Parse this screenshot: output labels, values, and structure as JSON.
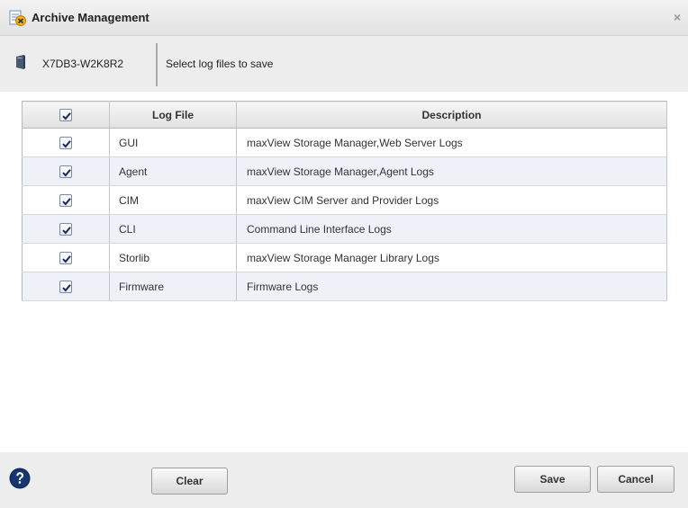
{
  "dialog": {
    "title": "Archive Management",
    "close_glyph": "×",
    "icon": "archive-management-icon"
  },
  "info": {
    "server_name": "X7DB3-W2K8R2",
    "server_icon": "server-icon",
    "instruction": "Select log files to save"
  },
  "table": {
    "headers": {
      "select_all_checked": true,
      "log_file": "Log File",
      "description": "Description"
    },
    "rows": [
      {
        "checked": true,
        "log_file": "GUI",
        "description": "maxView Storage Manager,Web Server Logs"
      },
      {
        "checked": true,
        "log_file": "Agent",
        "description": "maxView Storage Manager,Agent Logs"
      },
      {
        "checked": true,
        "log_file": "CIM",
        "description": "maxView CIM Server and Provider Logs"
      },
      {
        "checked": true,
        "log_file": "CLI",
        "description": "Command Line Interface Logs"
      },
      {
        "checked": true,
        "log_file": "Storlib",
        "description": "maxView Storage Manager Library Logs"
      },
      {
        "checked": true,
        "log_file": "Firmware",
        "description": "Firmware Logs"
      }
    ]
  },
  "footer": {
    "help_icon": "help-icon",
    "clear_label": "Clear",
    "save_label": "Save",
    "cancel_label": "Cancel"
  },
  "colors": {
    "alt_row": "#eef1f8",
    "panel_bg": "#ededed",
    "check_mark": "#1a2d55"
  }
}
